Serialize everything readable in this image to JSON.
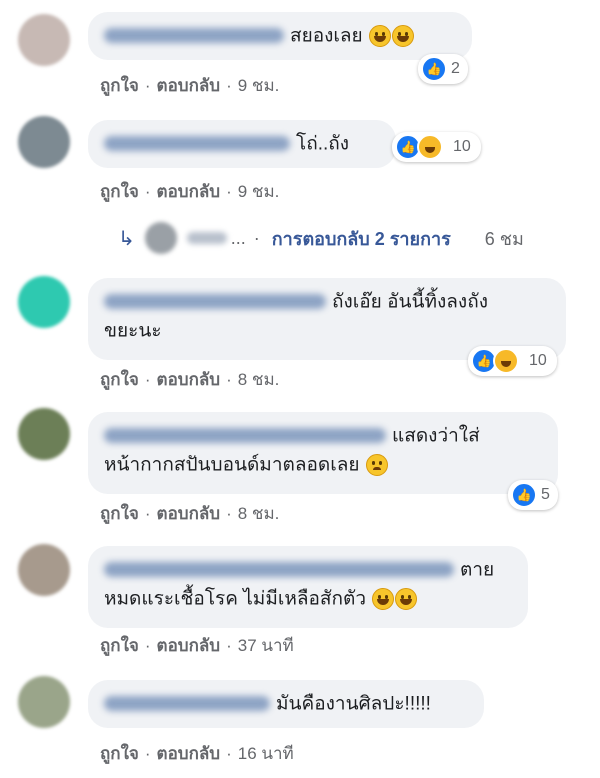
{
  "action_like": "ถูกใจ",
  "action_reply": "ตอบกลับ",
  "separator": "·",
  "comments": [
    {
      "text_lines": [
        "สยองเลย"
      ],
      "reaction_count": "2",
      "time": "9 ชม.",
      "avatar_color": "#c7b9b4"
    },
    {
      "text_lines": [
        "โถ่..ถัง"
      ],
      "reaction_count": "10",
      "time": "9 ชม.",
      "avatar_color": "#7d8a92"
    },
    {
      "text_lines": [
        "ถังเอ๊ย อันนี้ทิ้งลงถัง",
        "ขยะนะ"
      ],
      "reaction_count": "10",
      "time": "8 ชม.",
      "avatar_color": "#2ec9b0"
    },
    {
      "text_lines": [
        "แสดงว่าใส่",
        "หน้ากากสปันบอนด์มาตลอดเลย"
      ],
      "reaction_count": "5",
      "time": "8 ชม.",
      "avatar_color": "#6c7f57"
    },
    {
      "text_lines": [
        "ตาย",
        "หมดแระเชื้อโรค ไม่มีเหลือสักตัว"
      ],
      "time": "37 นาที",
      "avatar_color": "#a79a8d"
    },
    {
      "text_lines": [
        "มันคืองานศิลปะ!!!!!"
      ],
      "time": "16 นาที",
      "avatar_color": "#9aa58a"
    }
  ],
  "replies": {
    "ellipsis": "...",
    "label": "การตอบกลับ 2 รายการ",
    "time": "6 ชม"
  },
  "colors": {
    "like_blue": "#1877f2",
    "link": "#385898",
    "meta_gray": "#65676b",
    "bubble_bg": "#f0f2f5"
  }
}
